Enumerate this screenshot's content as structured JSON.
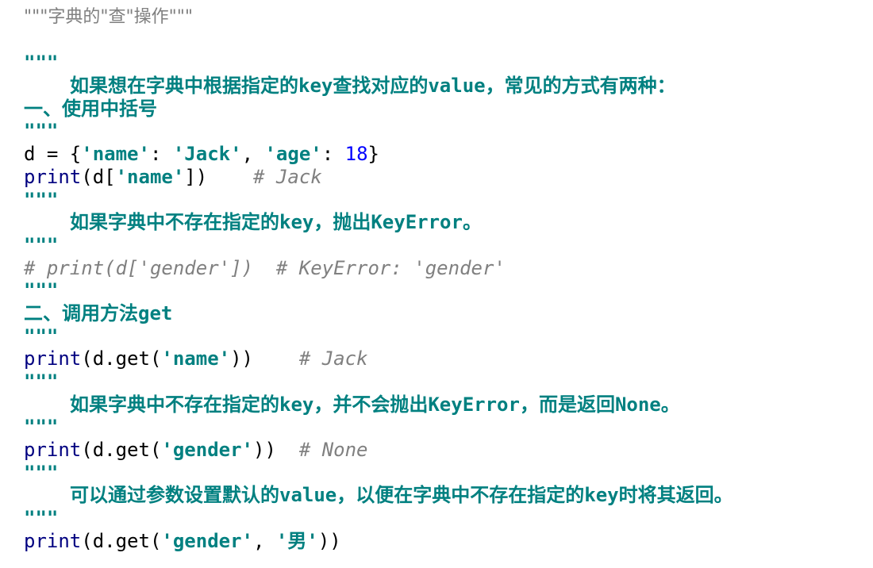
{
  "lines": {
    "l1": "\"\"\"字典的\"查\"操作\"\"\"",
    "l2": "",
    "l3": "\"\"\"",
    "l4": "如果想在字典中根据指定的key查找对应的value，常见的方式有两种：",
    "l5": "一、使用中括号",
    "l6": "\"\"\"",
    "l7_var": "d",
    "l7_eq": " = {",
    "l7_s1": "'name'",
    "l7_c1": ": ",
    "l7_s2": "'Jack'",
    "l7_c2": ", ",
    "l7_s3": "'age'",
    "l7_c3": ": ",
    "l7_n1": "18",
    "l7_end": "}",
    "l8_fn": "print",
    "l8_a": "(d[",
    "l8_s": "'name'",
    "l8_b": "])",
    "l8_sp": "    ",
    "l8_cm": "# Jack",
    "l9": "\"\"\"",
    "l10": "如果字典中不存在指定的key，抛出KeyError。",
    "l11": "\"\"\"",
    "l12": "# print(d['gender'])  # KeyError: 'gender'",
    "l13": "\"\"\"",
    "l14": "二、调用方法get",
    "l15": "\"\"\"",
    "l16_fn": "print",
    "l16_a": "(d.get(",
    "l16_s": "'name'",
    "l16_b": "))",
    "l16_sp": "    ",
    "l16_cm": "# Jack",
    "l17": "\"\"\"",
    "l18": "如果字典中不存在指定的key，并不会抛出KeyError，而是返回None。",
    "l19": "\"\"\"",
    "l20_fn": "print",
    "l20_a": "(d.get(",
    "l20_s": "'gender'",
    "l20_b": "))",
    "l20_sp": "  ",
    "l20_cm": "# None",
    "l21": "\"\"\"",
    "l22": "可以通过参数设置默认的value，以便在字典中不存在指定的key时将其返回。",
    "l23": "\"\"\"",
    "l24_fn": "print",
    "l24_a": "(d.get(",
    "l24_s1": "'gender'",
    "l24_c": ", ",
    "l24_s2": "'男'",
    "l24_b": "))"
  },
  "colors": {
    "docstring": "#008080",
    "number": "#0000ff",
    "builtin": "#000080",
    "comment": "#808080"
  }
}
